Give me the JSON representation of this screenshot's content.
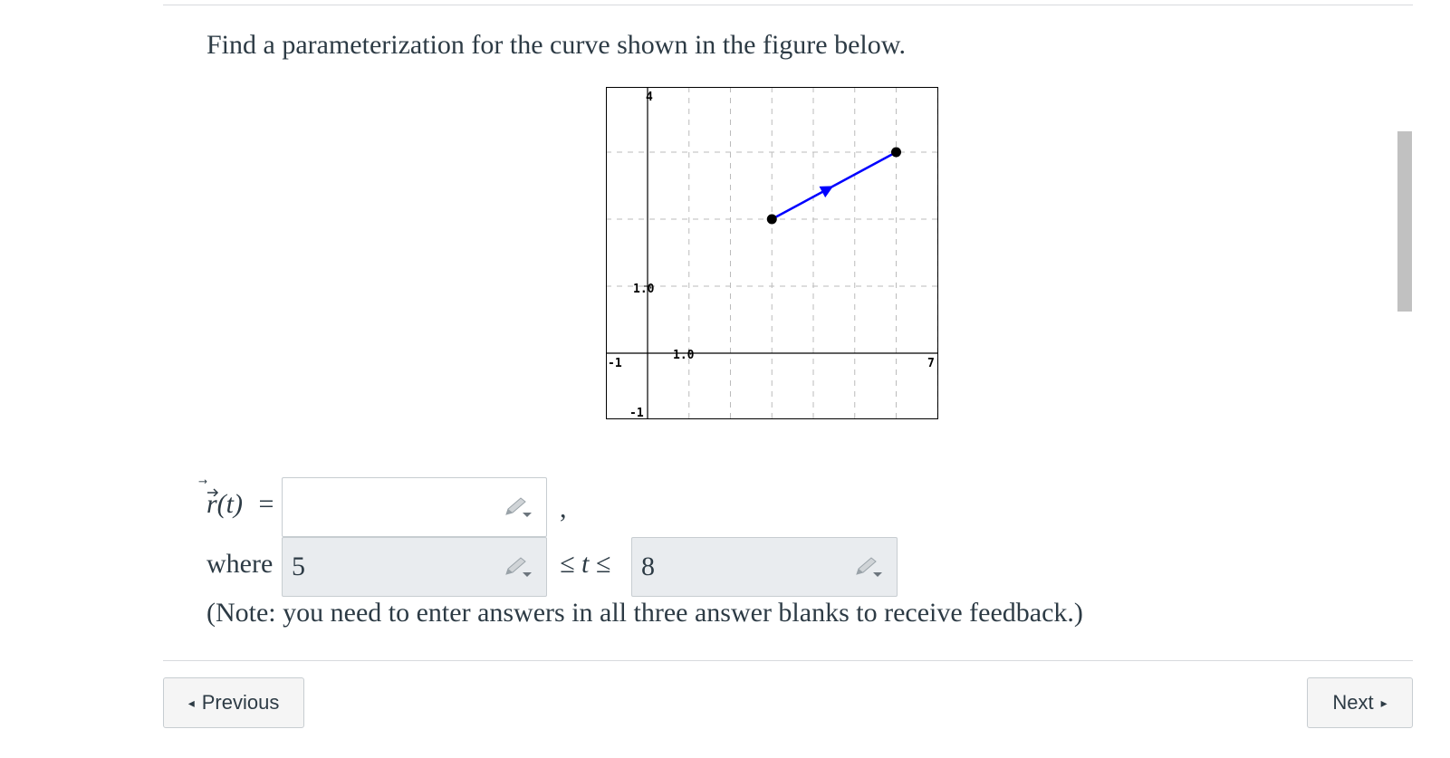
{
  "question": {
    "text": "Find a parameterization for the curve shown in the figure below."
  },
  "graph": {
    "x_range": [
      -1,
      7
    ],
    "y_range": [
      -1,
      4
    ],
    "labels": {
      "y_top": "4",
      "x_right": "7",
      "x_left": "-1",
      "y_bottom": "-1",
      "y_tick": "1.0",
      "x_tick": "1.0"
    },
    "segment": {
      "start": [
        3,
        2
      ],
      "end": [
        6,
        3
      ],
      "color": "#0000ff",
      "direction": "start-to-end"
    },
    "grid": "dashed"
  },
  "answer": {
    "r_label": "r(t)",
    "equals": "=",
    "comma": ",",
    "where_label": "where",
    "lower_value": "5",
    "leq_t_leq": "≤ t ≤",
    "upper_value": "8",
    "r_value": ""
  },
  "note": "(Note: you need to enter answers in all three answer blanks to receive feedback.)",
  "nav": {
    "previous_label": "Previous",
    "next_label": "Next"
  },
  "icons": {
    "prev": "triangle-left-icon",
    "next": "triangle-right-icon",
    "edit": "pencil-icon"
  }
}
